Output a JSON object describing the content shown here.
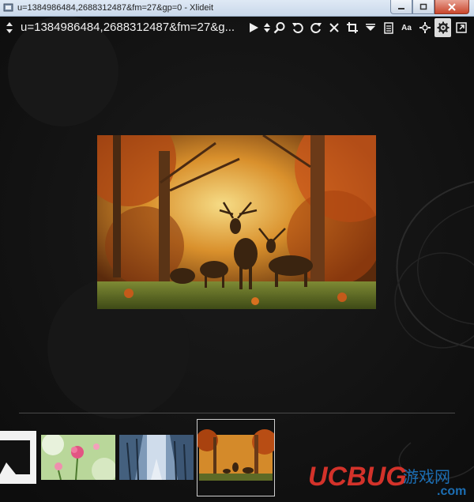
{
  "window": {
    "title": "u=1384986484,2688312487&fm=27&gp=0 - Xlideit"
  },
  "toolbar": {
    "filename": "u=1384986484,2688312487&fm=27&g...",
    "tools": [
      {
        "name": "play-icon",
        "glyph": "▶"
      },
      {
        "name": "zoom-icon",
        "glyph": "zoom"
      },
      {
        "name": "rotate-left-icon",
        "glyph": "rotl"
      },
      {
        "name": "rotate-right-icon",
        "glyph": "rotr"
      },
      {
        "name": "delete-icon",
        "glyph": "x"
      },
      {
        "name": "crop-icon",
        "glyph": "crop"
      },
      {
        "name": "sort-menu-icon",
        "glyph": "menu"
      },
      {
        "name": "info-icon",
        "glyph": "doc"
      },
      {
        "name": "font-icon",
        "glyph": "Aa"
      },
      {
        "name": "fit-icon",
        "glyph": "fit"
      },
      {
        "name": "settings-icon",
        "glyph": "gear"
      },
      {
        "name": "external-window-icon",
        "glyph": "ext"
      }
    ],
    "font_tool_label": "Aa"
  },
  "thumbnails": [
    {
      "name": "thumbnail-dark-partial",
      "selected": false
    },
    {
      "name": "thumbnail-flowers",
      "selected": false
    },
    {
      "name": "thumbnail-snow-forest",
      "selected": false
    },
    {
      "name": "thumbnail-autumn-deer",
      "selected": true
    }
  ],
  "watermark": {
    "brand": "UCBUG",
    "site_suffix": "游戏网",
    "domain": ".com"
  },
  "colors": {
    "background": "#141414",
    "toolbar_text": "#f0f0f0",
    "watermark_red": "#d3322a",
    "watermark_blue": "#1f7fd0"
  }
}
